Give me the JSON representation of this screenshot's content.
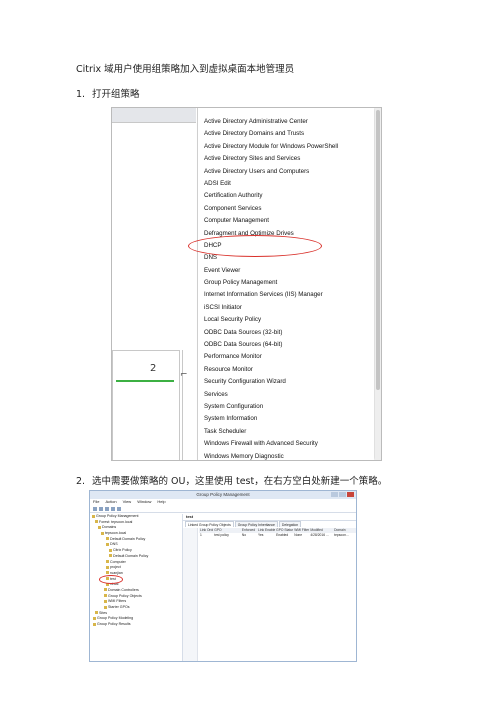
{
  "doc": {
    "title": "Citrix 域用户使用组策略加入到虚拟桌面本地管理员"
  },
  "steps": [
    {
      "num": "1.",
      "text": "打开组策略"
    },
    {
      "num": "2.",
      "text": "选中需要做策略的 OU，这里使用 test，在右方空白处新建一个策略。"
    }
  ],
  "screenshot1": {
    "tile_number": "2",
    "tick": "⌐",
    "menu_items": [
      "Active Directory Administrative Center",
      "Active Directory Domains and Trusts",
      "Active Directory Module for Windows PowerShell",
      "Active Directory Sites and Services",
      "Active Directory Users and Computers",
      "ADSI Edit",
      "Certification Authority",
      "Component Services",
      "Computer Management",
      "Defragment and Optimize Drives",
      "DHCP",
      "DNS",
      "Event Viewer",
      "Group Policy Management",
      "Internet Information Services (IIS) Manager",
      "iSCSI Initiator",
      "Local Security Policy",
      "ODBC Data Sources (32-bit)",
      "ODBC Data Sources (64-bit)",
      "Performance Monitor",
      "Resource Monitor",
      "Security Configuration Wizard",
      "Services",
      "System Configuration",
      "System Information",
      "Task Scheduler",
      "Windows Firewall with Advanced Security",
      "Windows Memory Diagnostic"
    ],
    "highlight_color": "#d9302a"
  },
  "screenshot2": {
    "window_title": "Group Policy Management",
    "menu": [
      "File",
      "Action",
      "View",
      "Window",
      "Help"
    ],
    "tree": [
      "Group Policy Management",
      "Forest: tepsoon.local",
      "Domains",
      "tepsoon.local",
      "Default Domain Policy",
      "DNS",
      "Citrix Policy",
      "Default Domain Policy",
      "Computer",
      "project",
      "ruanjian",
      "test",
      "xintai",
      "Domain Controllers",
      "Group Policy Objects",
      "WMI Filters",
      "Starter GPOs",
      "Sites",
      "Group Policy Modeling",
      "Group Policy Results"
    ],
    "right_title": "test",
    "tabs": [
      "Linked Group Policy Objects",
      "Group Policy Inheritance",
      "Delegation"
    ],
    "columns": [
      "Link Order",
      "GPO",
      "Enforced",
      "Link Enabled",
      "GPO Status",
      "WMI Filter",
      "Modified",
      "Domain"
    ],
    "rows": [
      [
        "1",
        "test policy",
        "No",
        "Yes",
        "Enabled",
        "None",
        "4/28/2016 ...",
        "tepsoon..."
      ]
    ]
  }
}
